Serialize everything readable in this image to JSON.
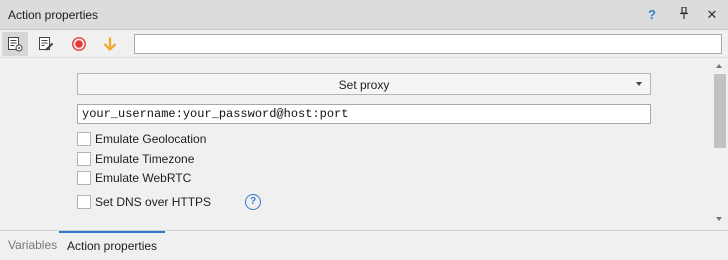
{
  "panel": {
    "title": "Action properties",
    "help_icon": "question-icon",
    "pin_icon": "pin-icon",
    "close_icon": "close-icon"
  },
  "toolbar": {
    "tools": [
      {
        "icon": "properties-list-icon",
        "active": true
      },
      {
        "icon": "edit-note-icon",
        "active": false
      },
      {
        "icon": "record-icon",
        "color": "#e53935"
      },
      {
        "icon": "arrow-down-icon",
        "color": "#f5a623"
      }
    ],
    "input_value": ""
  },
  "action": {
    "selected": "Set proxy",
    "proxy_value": "your_username:your_password@host:port",
    "options": [
      {
        "label": "Emulate Geolocation",
        "checked": false
      },
      {
        "label": "Emulate Timezone",
        "checked": false
      },
      {
        "label": "Emulate WebRTC",
        "checked": false
      },
      {
        "label": "Set DNS over HTTPS",
        "checked": false
      }
    ]
  },
  "tabs": [
    {
      "label": "Variables",
      "active": false
    },
    {
      "label": "Action properties",
      "active": true
    }
  ]
}
